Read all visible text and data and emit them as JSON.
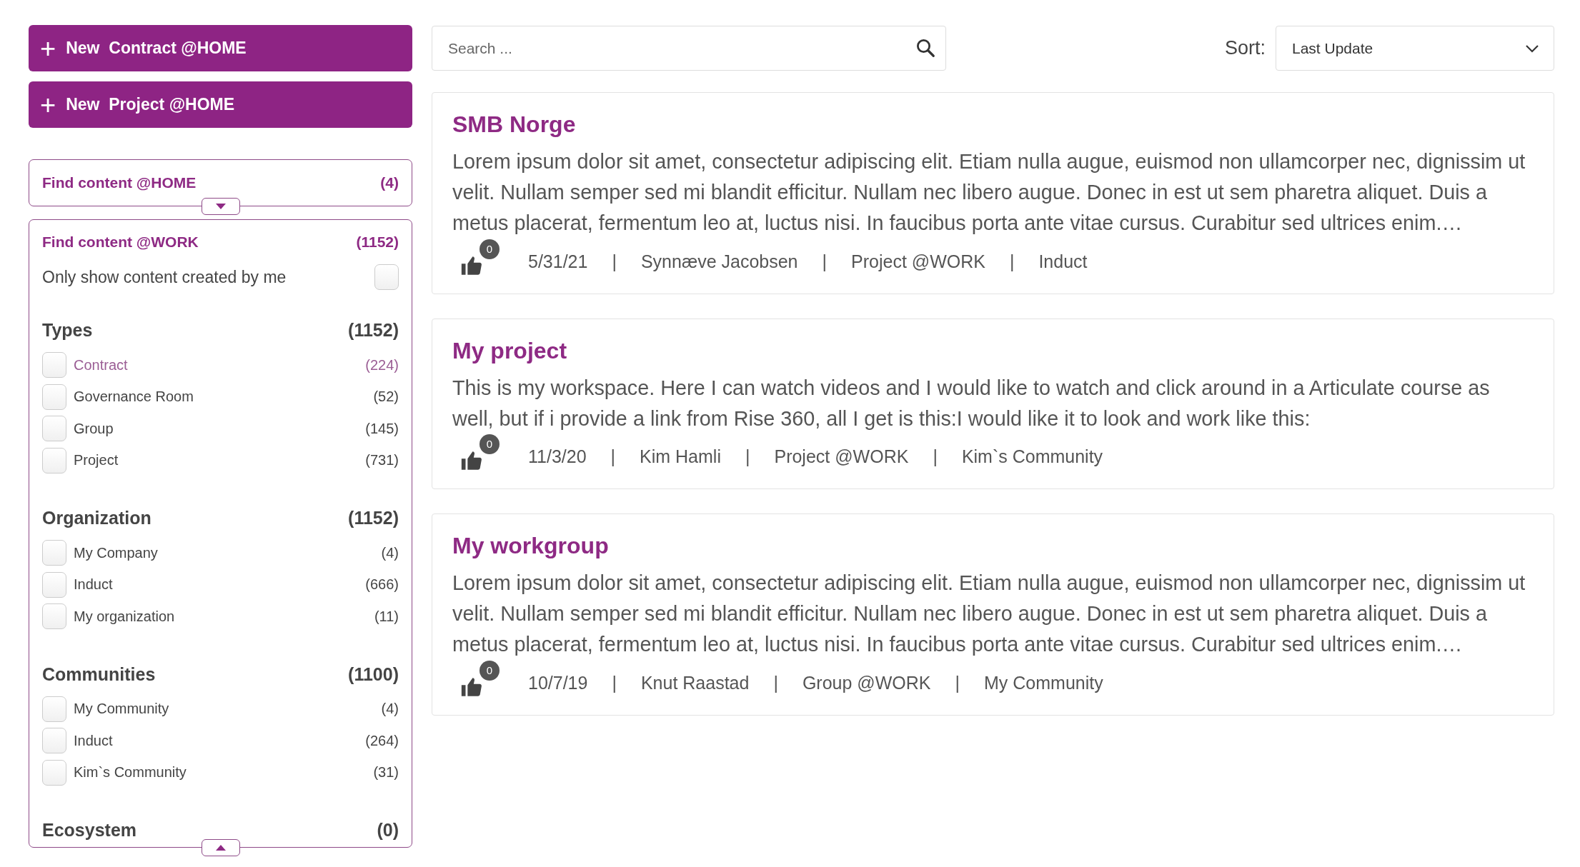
{
  "actions": [
    {
      "plus": "+",
      "label": "New  Contract @HOME"
    },
    {
      "plus": "+",
      "label": "New  Project @HOME"
    }
  ],
  "home_filter": {
    "title": "Find content @HOME",
    "count": "(4)",
    "expanded": false
  },
  "work_filter": {
    "title": "Find content @WORK",
    "count": "(1152)",
    "expanded": true,
    "only_mine": {
      "label": "Only show content created by me",
      "checked": false
    },
    "groups": [
      {
        "title": "Types",
        "count": "(1152)",
        "items": [
          {
            "label": "Contract",
            "count": "(224)",
            "checked": false,
            "highlighted": true
          },
          {
            "label": "Governance Room",
            "count": "(52)",
            "checked": false,
            "highlighted": false
          },
          {
            "label": "Group",
            "count": "(145)",
            "checked": false,
            "highlighted": false
          },
          {
            "label": "Project",
            "count": "(731)",
            "checked": false,
            "highlighted": false
          }
        ]
      },
      {
        "title": "Organization",
        "count": "(1152)",
        "items": [
          {
            "label": "My Company",
            "count": "(4)",
            "checked": false,
            "highlighted": false
          },
          {
            "label": "Induct",
            "count": "(666)",
            "checked": false,
            "highlighted": false
          },
          {
            "label": "My organization",
            "count": "(11)",
            "checked": false,
            "highlighted": false
          }
        ]
      },
      {
        "title": "Communities",
        "count": "(1100)",
        "items": [
          {
            "label": "My Community",
            "count": "(4)",
            "checked": false,
            "highlighted": false
          },
          {
            "label": "Induct",
            "count": "(264)",
            "checked": false,
            "highlighted": false
          },
          {
            "label": "Kim`s Community",
            "count": "(31)",
            "checked": false,
            "highlighted": false
          }
        ]
      },
      {
        "title": "Ecosystem",
        "count": "(0)"
      }
    ]
  },
  "search": {
    "placeholder": "Search ..."
  },
  "sort": {
    "label": "Sort:",
    "value": "Last Update"
  },
  "cards": [
    {
      "title": "SMB Norge",
      "body": "Lorem ipsum dolor sit amet, consectetur adipiscing elit. Etiam nulla augue, euismod non ullamcorper nec, dignissim ut velit. Nullam semper sed mi blandit efficitur. Nullam nec libero augue. Donec in est ut sem pharetra aliquet. Duis a metus placerat, fermentum leo at, luctus nisi. In faucibus porta ante vitae cursus. Curabitur sed ultrices enim.…",
      "likes": "0",
      "meta": [
        "5/31/21",
        "|",
        "Synnæve Jacobsen",
        "|",
        "Project @WORK",
        "|",
        "Induct"
      ]
    },
    {
      "title": "My project",
      "body": "This is my workspace. Here I can watch videos and I would like to watch and click around in a Articulate course as well, but if i provide a link from Rise 360, all I get is this:I would like it to look and work like this:",
      "likes": "0",
      "meta": [
        "11/3/20",
        "|",
        "Kim Hamli",
        "|",
        "Project @WORK",
        "|",
        "Kim`s Community"
      ]
    },
    {
      "title": "My workgroup",
      "body": "Lorem ipsum dolor sit amet, consectetur adipiscing elit. Etiam nulla augue, euismod non ullamcorper nec, dignissim ut velit. Nullam semper sed mi blandit efficitur. Nullam nec libero augue. Donec in est ut sem pharetra aliquet. Duis a metus placerat, fermentum leo at, luctus nisi. In faucibus porta ante vitae cursus. Curabitur sed ultrices enim.…",
      "likes": "0",
      "meta": [
        "10/7/19",
        "|",
        "Knut Raastad",
        "|",
        "Group @WORK",
        "|",
        "My Community"
      ]
    }
  ]
}
